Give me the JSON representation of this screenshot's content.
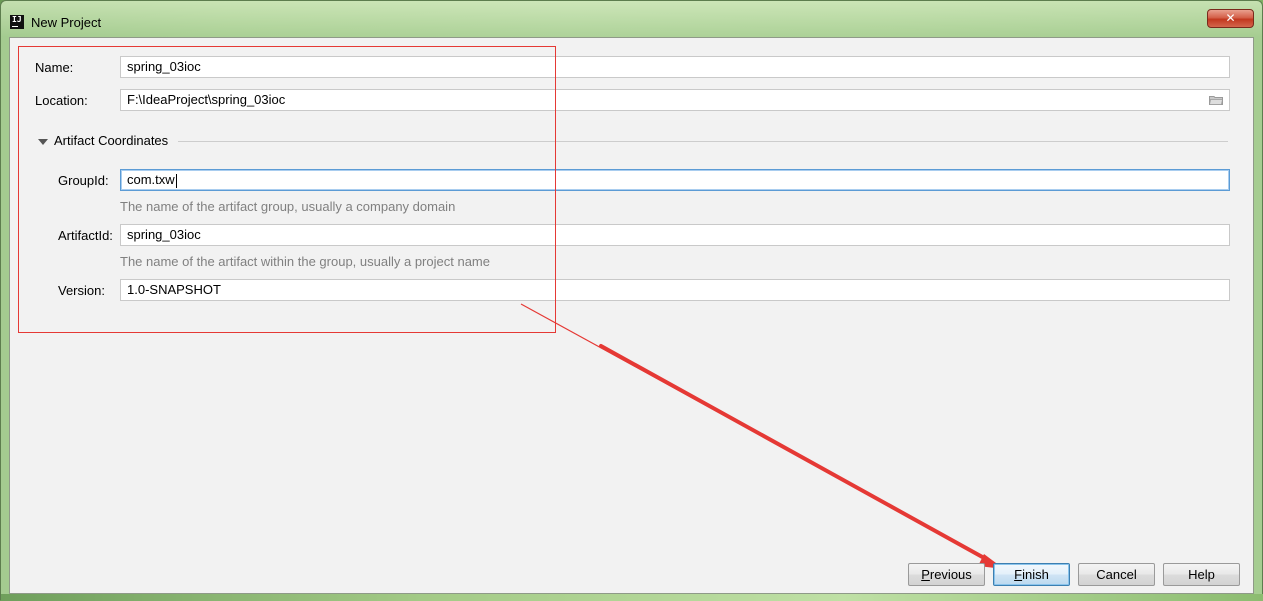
{
  "window": {
    "title": "New Project",
    "app_icon_text": "IJ",
    "close_glyph": "✕"
  },
  "form": {
    "name": {
      "label": "Name:",
      "value": "spring_03ioc"
    },
    "location": {
      "label": "Location:",
      "value": "F:\\IdeaProject\\spring_03ioc",
      "icon": "folder-icon"
    },
    "artifact_section": {
      "title": "Artifact Coordinates",
      "expanded": true
    },
    "group_id": {
      "label": "GroupId:",
      "value": "com.txw",
      "hint": "The name of the artifact group, usually a company domain"
    },
    "artifact_id": {
      "label": "ArtifactId:",
      "value": "spring_03ioc",
      "hint": "The name of the artifact within the group, usually a project name"
    },
    "version": {
      "label": "Version:",
      "value": "1.0-SNAPSHOT"
    }
  },
  "buttons": {
    "previous": {
      "mnemonic": "P",
      "rest": "revious"
    },
    "finish": {
      "mnemonic": "F",
      "rest": "inish"
    },
    "cancel": "Cancel",
    "help": "Help"
  },
  "colors": {
    "annotation": "#e53935",
    "focus_border": "#5b9bd5",
    "dialog_background": "#f2f2f2",
    "hint_text": "#808080"
  }
}
